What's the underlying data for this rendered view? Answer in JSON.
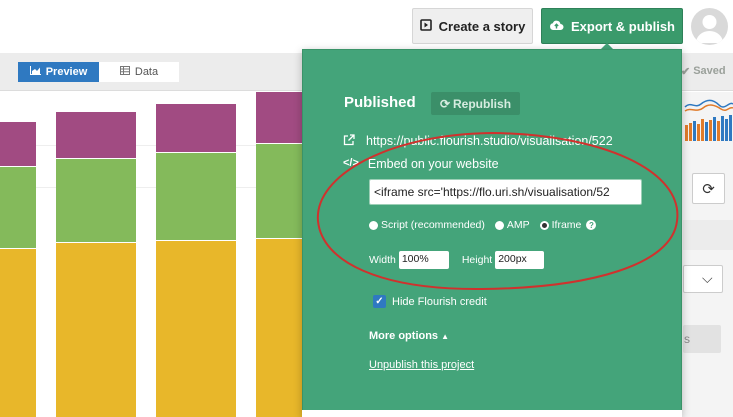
{
  "header": {
    "create_story_label": "Create a story",
    "export_publish_label": "Export & publish"
  },
  "toolbar": {
    "tabs": [
      {
        "label": "Preview",
        "icon": "chart-icon",
        "active": true
      },
      {
        "label": "Data",
        "icon": "table-icon",
        "active": false
      }
    ],
    "saved_label": "Saved"
  },
  "publish_panel": {
    "title": "Published",
    "republish_label": "Republish",
    "public_url": "https://public.flourish.studio/visualisation/522",
    "embed_label": "Embed on your website",
    "embed_code": "<iframe src='https://flo.uri.sh/visualisation/52",
    "embed_options": [
      {
        "label": "Script (recommended)",
        "selected": false
      },
      {
        "label": "AMP",
        "selected": false
      },
      {
        "label": "Iframe",
        "selected": true
      }
    ],
    "width_label": "Width",
    "width_value": "100%",
    "height_label": "Height",
    "height_value": "200px",
    "hide_credit_label": "Hide Flourish credit",
    "hide_credit_checked": true,
    "more_options_label": "More options",
    "unpublish_label": "Unpublish this project"
  },
  "side_panel": {
    "fragment_text": "s"
  },
  "colors": {
    "accent_green": "#44a47a",
    "button_green": "#3a9a6b",
    "preview_blue": "#2f79c1",
    "bar_top": "#a14b82",
    "bar_mid": "#84ba5b",
    "bar_bottom": "#e8b72a",
    "annotation_red": "#d0312d"
  }
}
